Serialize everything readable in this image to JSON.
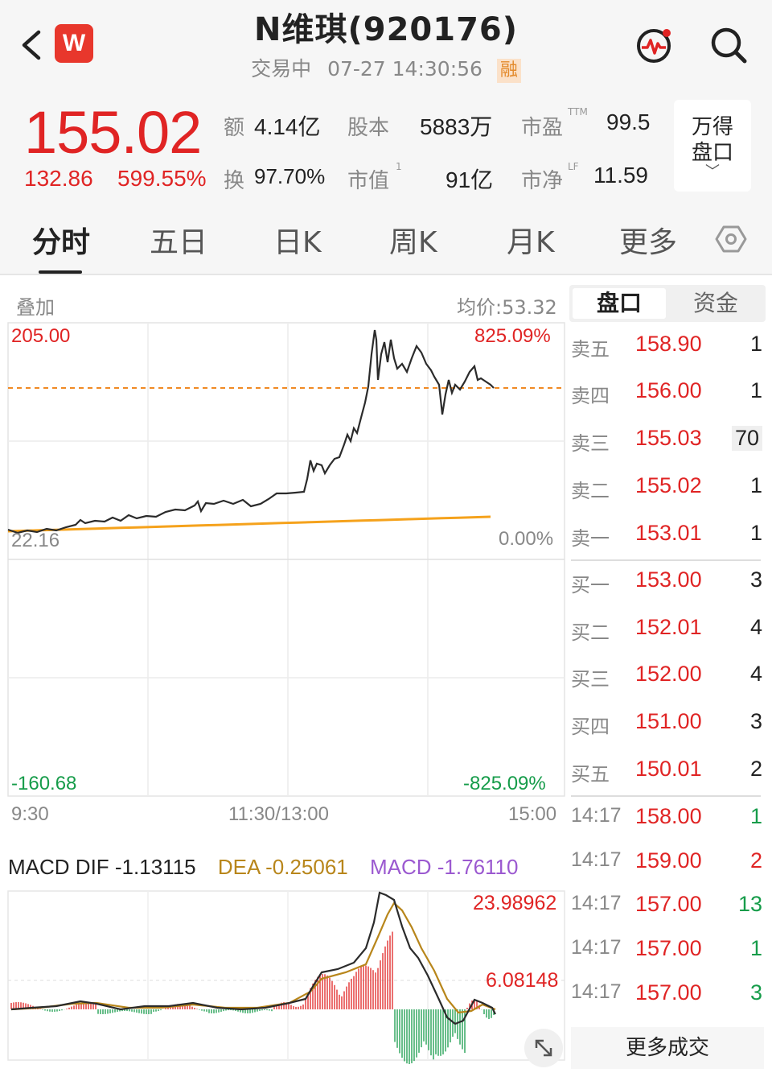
{
  "header": {
    "title": "N维琪(920176)",
    "status": "交易中",
    "datetime": "07-27 14:30:56",
    "badge": "融",
    "logo_letter": "W"
  },
  "quote": {
    "price": "155.02",
    "change": "132.86",
    "change_pct": "599.55%",
    "amount_label": "额",
    "amount": "4.14亿",
    "capital_label": "股本",
    "capital": "5883万",
    "pe_label": "市盈",
    "pe_sup": "TTM",
    "pe": "99.5",
    "turnover_label": "换",
    "turnover": "97.70%",
    "mcap_label": "市值",
    "mcap_sup": "1",
    "mcap": "91亿",
    "pb_label": "市净",
    "pb_sup": "LF",
    "pb": "11.59",
    "wande_line1": "万得",
    "wande_line2": "盘口",
    "wande_chevron": "﹀"
  },
  "tabs": [
    "分时",
    "五日",
    "日K",
    "周K",
    "月K",
    "更多"
  ],
  "chart": {
    "overlay_label": "叠加",
    "avg_price_label": "均价:53.32",
    "y_top": "205.00",
    "y_top_pct": "825.09%",
    "y_mid": "22.16",
    "y_mid_pct": "0.00%",
    "y_bottom": "-160.68",
    "y_bottom_pct": "-825.09%",
    "x_start": "9:30",
    "x_mid": "11:30/13:00",
    "x_end": "15:00",
    "colors": {
      "price": "#2b2b2b",
      "avg": "#f5a21c",
      "ref": "#f08a24",
      "up": "#e02424",
      "down": "#169c4a"
    }
  },
  "macd": {
    "name": "MACD",
    "dif": "DIF -1.13115",
    "dea": "DEA -0.25061",
    "macd": "MACD -1.76110",
    "y_top": "23.98962",
    "y_mid": "6.08148",
    "colors": {
      "dif": "#2b2b2b",
      "dea": "#b8861b",
      "macd": "#9b59d0"
    }
  },
  "orderbook": {
    "tab_active": "盘口",
    "tab_inactive": "资金",
    "asks": [
      {
        "label": "卖五",
        "price": "158.90",
        "vol": "1"
      },
      {
        "label": "卖四",
        "price": "156.00",
        "vol": "1"
      },
      {
        "label": "卖三",
        "price": "155.03",
        "vol": "70"
      },
      {
        "label": "卖二",
        "price": "155.02",
        "vol": "1"
      },
      {
        "label": "卖一",
        "price": "153.01",
        "vol": "1"
      }
    ],
    "bids": [
      {
        "label": "买一",
        "price": "153.00",
        "vol": "3"
      },
      {
        "label": "买二",
        "price": "152.01",
        "vol": "4"
      },
      {
        "label": "买三",
        "price": "152.00",
        "vol": "4"
      },
      {
        "label": "买四",
        "price": "151.00",
        "vol": "3"
      },
      {
        "label": "买五",
        "price": "150.01",
        "vol": "2"
      }
    ]
  },
  "trades": [
    {
      "time": "14:17",
      "price": "158.00",
      "vol": "1",
      "dir": "buy"
    },
    {
      "time": "14:17",
      "price": "159.00",
      "vol": "2",
      "dir": "sell"
    },
    {
      "time": "14:17",
      "price": "157.00",
      "vol": "13",
      "dir": "buy"
    },
    {
      "time": "14:17",
      "price": "157.00",
      "vol": "1",
      "dir": "buy"
    },
    {
      "time": "14:17",
      "price": "157.00",
      "vol": "3",
      "dir": "buy"
    }
  ],
  "more_trades": "更多成交"
}
